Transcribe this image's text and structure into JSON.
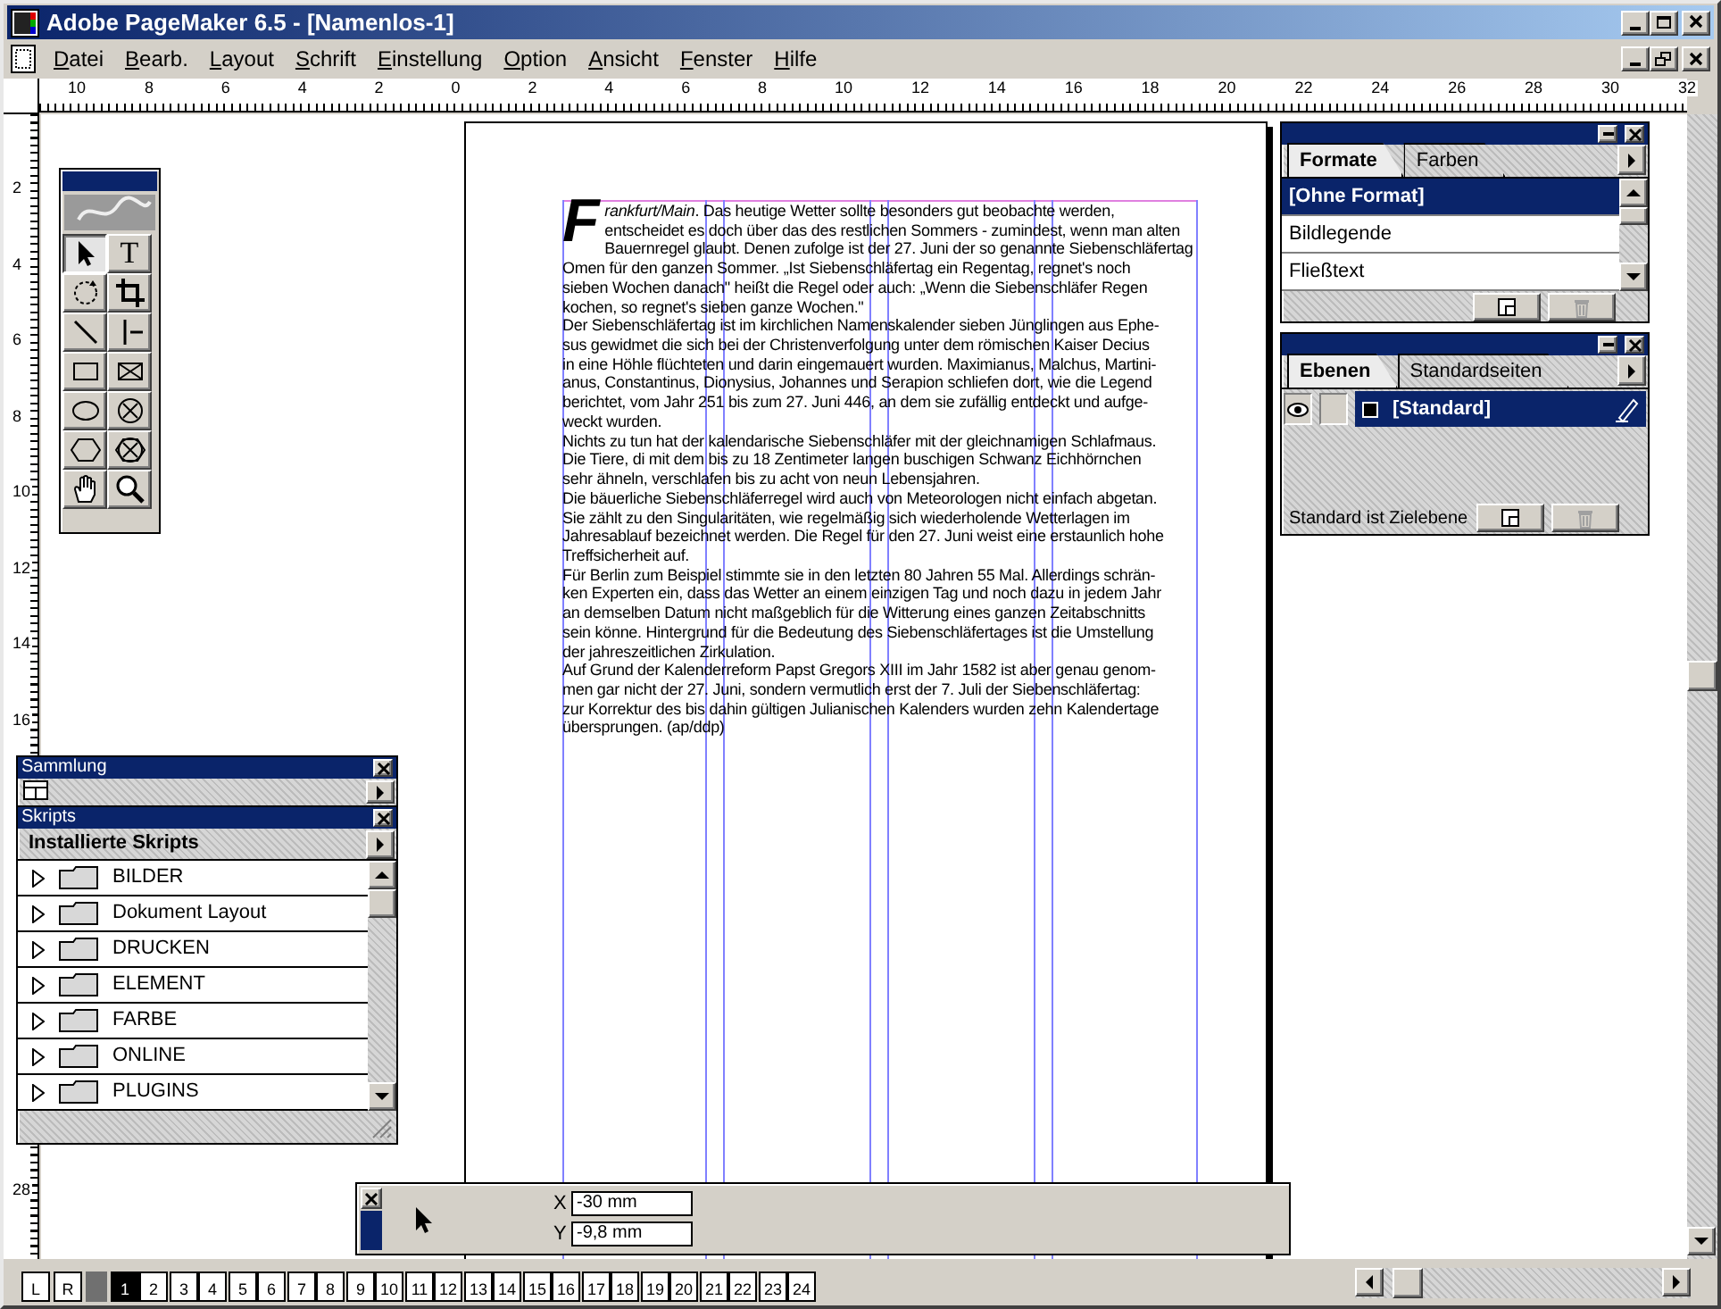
{
  "window": {
    "title": "Adobe PageMaker 6.5 - [Namenlos-1]"
  },
  "menu": [
    "Datei",
    "Bearb.",
    "Layout",
    "Schrift",
    "Einstellung",
    "Option",
    "Ansicht",
    "Fenster",
    "Hilfe"
  ],
  "rulers": {
    "horizontal": [
      "10",
      "8",
      "6",
      "4",
      "2",
      "0",
      "2",
      "4",
      "6",
      "8",
      "10",
      "12",
      "14",
      "16",
      "18",
      "20",
      "22",
      "24",
      "26",
      "28",
      "30",
      "32"
    ],
    "vertical": [
      "2",
      "4",
      "6",
      "8",
      "10",
      "12",
      "14",
      "16"
    ],
    "vertical_lower": [
      "28"
    ]
  },
  "toolbox": {
    "tools": [
      {
        "kind": "pointer",
        "selected": true
      },
      {
        "kind": "text",
        "glyph": "T",
        "selected": false
      },
      {
        "kind": "rotate",
        "selected": false
      },
      {
        "kind": "crop",
        "selected": false
      },
      {
        "kind": "line",
        "selected": false
      },
      {
        "kind": "constrained-line",
        "selected": false
      },
      {
        "kind": "rectangle",
        "selected": false
      },
      {
        "kind": "rectangle-frame",
        "selected": false
      },
      {
        "kind": "ellipse",
        "selected": false
      },
      {
        "kind": "ellipse-frame",
        "selected": false
      },
      {
        "kind": "polygon",
        "selected": false
      },
      {
        "kind": "polygon-frame",
        "selected": false
      },
      {
        "kind": "hand",
        "selected": false
      },
      {
        "kind": "zoom",
        "selected": false
      }
    ]
  },
  "document": {
    "drop_cap": "F",
    "lines": [
      "*rankfurt/Main*. Das heutige Wetter sollte besonders gut beobachte werden,",
      "entscheidet es doch über das des restlichen Sommers - zumindest, wenn man alten",
      "Bauernregel glaubt. Denen zufolge ist der 27. Juni der so genannte Siebenschläfertag",
      "Omen für den ganzen Sommer. „Ist Siebenschläfertag ein Regentag, regnet's noch",
      "sieben Wochen danach\" heißt die Regel oder auch: „Wenn die Siebenschläfer Regen",
      "kochen, so regnet's sieben ganze Wochen.\"",
      "Der Siebenschläfertag ist im kirchlichen Namenskalender sieben Jünglingen aus Ephe-",
      "sus gewidmet die sich bei der Christenverfolgung unter dem römischen Kaiser Decius",
      "in eine Höhle flüchteten und darin eingemauert wurden. Maximianus, Malchus, Martini-",
      "anus, Constantinus, Dionysius, Johannes und Serapion schliefen dort, wie die Legend",
      "berichtet, vom Jahr 251 bis zum 27. Juni 446, an dem sie zufällig entdeckt und aufge-",
      "weckt wurden.",
      "Nichts zu tun hat der kalendarische Siebenschläfer mit der gleichnamigen Schlafmaus.",
      "Die Tiere, di mit dem bis zu 18 Zentimeter langen buschigen Schwanz Eichhörnchen",
      "sehr ähneln, verschlafen bis zu acht von neun Lebensjahren.",
      "Die bäuerliche Siebenschläferregel wird auch von Meteorologen nicht einfach abgetan.",
      "Sie zählt zu den Singularitäten, wie regelmäßig sich wiederholende Wetterlagen im",
      "Jahresablauf bezeichnet werden. Die Regel für den 27. Juni weist eine erstaunlich hohe",
      "Treffsicherheit auf.",
      "Für Berlin zum Beispiel stimmte sie in den letzten 80 Jahren 55 Mal. Allerdings schrän-",
      "ken Experten ein, dass das Wetter an einem einzigen Tag und noch dazu in jedem Jahr",
      "an demselben Datum nicht maßgeblich für die Witterung eines ganzen Zeitabschnitts",
      "sein könne. Hintergrund für die Bedeutung des Siebenschläfertages ist die Umstellung",
      "der jahreszeitlichen Zirkulation.",
      "Auf Grund der Kalenderreform Papst Gregors XIII im Jahr 1582 ist aber genau genom-",
      "men gar nicht der 27. Juni, sondern vermutlich erst der 7. Juli der Siebenschläfertag:",
      "zur Korrektur des bis dahin gültigen Julianischen Kalenders wurden zehn Kalendertage",
      "übersprungen. (ap/ddp)"
    ]
  },
  "formats_palette": {
    "tabs": [
      {
        "label": "Formate",
        "selected": true
      },
      {
        "label": "Farben",
        "selected": false
      }
    ],
    "styles": [
      {
        "label": "[Ohne Format]",
        "selected": true
      },
      {
        "label": "Bildlegende",
        "selected": false
      },
      {
        "label": "Fließtext",
        "selected": false
      }
    ]
  },
  "layers_palette": {
    "tabs": [
      {
        "label": "Ebenen",
        "selected": true
      },
      {
        "label": "Standardseiten",
        "selected": false
      }
    ],
    "layers": [
      {
        "label": "[Standard]",
        "visible": true,
        "locked": false,
        "selected": true
      }
    ],
    "status": "Standard ist Zielebene"
  },
  "library_palette": {
    "title": "Sammlung"
  },
  "scripts_palette": {
    "title": "Skripts",
    "header": "Installierte Skripts",
    "folders": [
      "BILDER",
      "Dokument Layout",
      "DRUCKEN",
      "ELEMENT",
      "FARBE",
      "ONLINE",
      "PLUGINS"
    ]
  },
  "control_palette": {
    "x_label": "X",
    "x_value": "-30 mm",
    "y_label": "Y",
    "y_value": "-9,8 mm"
  },
  "page_icons": {
    "masters": [
      "L",
      "R"
    ],
    "pages": [
      {
        "label": "1",
        "selected": true
      },
      {
        "label": "2",
        "selected": false
      },
      {
        "label": "3",
        "selected": false
      },
      {
        "label": "4",
        "selected": false
      },
      {
        "label": "5",
        "selected": false
      },
      {
        "label": "6",
        "selected": false
      },
      {
        "label": "7",
        "selected": false
      },
      {
        "label": "8",
        "selected": false
      },
      {
        "label": "9",
        "selected": false
      },
      {
        "label": "10",
        "selected": false
      },
      {
        "label": "11",
        "selected": false
      },
      {
        "label": "12",
        "selected": false
      },
      {
        "label": "13",
        "selected": false
      },
      {
        "label": "14",
        "selected": false
      },
      {
        "label": "15",
        "selected": false
      },
      {
        "label": "16",
        "selected": false
      },
      {
        "label": "17",
        "selected": false
      },
      {
        "label": "18",
        "selected": false
      },
      {
        "label": "19",
        "selected": false
      },
      {
        "label": "20",
        "selected": false
      },
      {
        "label": "21",
        "selected": false
      },
      {
        "label": "22",
        "selected": false
      },
      {
        "label": "23",
        "selected": false
      },
      {
        "label": "24",
        "selected": false
      }
    ]
  }
}
